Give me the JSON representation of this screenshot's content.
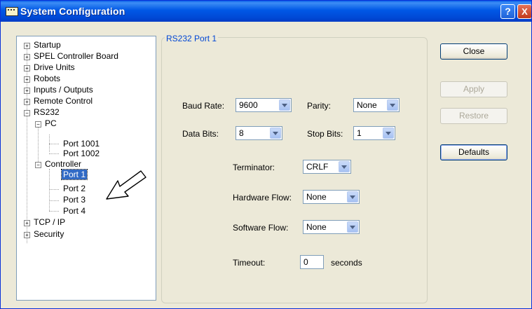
{
  "window": {
    "title": "System Configuration",
    "help_glyph": "?",
    "close_glyph": "X"
  },
  "tree": {
    "startup": "Startup",
    "spel_board": "SPEL Controller Board",
    "drive_units": "Drive Units",
    "robots": "Robots",
    "inputs_outputs": "Inputs / Outputs",
    "remote_control": "Remote Control",
    "rs232": "RS232",
    "pc": "PC",
    "port_1001": "Port 1001",
    "port_1002": "Port 1002",
    "controller": "Controller",
    "port_1": "Port 1",
    "port_2": "Port 2",
    "port_3": "Port 3",
    "port_4": "Port 4",
    "tcp_ip": "TCP / IP",
    "security": "Security"
  },
  "panel": {
    "group_title": "RS232 Port 1",
    "baud_rate_label": "Baud Rate:",
    "baud_rate_value": "9600",
    "parity_label": "Parity:",
    "parity_value": "None",
    "data_bits_label": "Data Bits:",
    "data_bits_value": "8",
    "stop_bits_label": "Stop Bits:",
    "stop_bits_value": "1",
    "terminator_label": "Terminator:",
    "terminator_value": "CRLF",
    "hardware_flow_label": "Hardware Flow:",
    "hardware_flow_value": "None",
    "software_flow_label": "Software Flow:",
    "software_flow_value": "None",
    "timeout_label": "Timeout:",
    "timeout_value": "0",
    "timeout_unit": "seconds"
  },
  "buttons": {
    "close": "Close",
    "apply": "Apply",
    "restore": "Restore",
    "defaults": "Defaults"
  },
  "colors": {
    "selection": "#316ac5",
    "group_title": "#0046d5",
    "titlebar": "#0058e6"
  }
}
